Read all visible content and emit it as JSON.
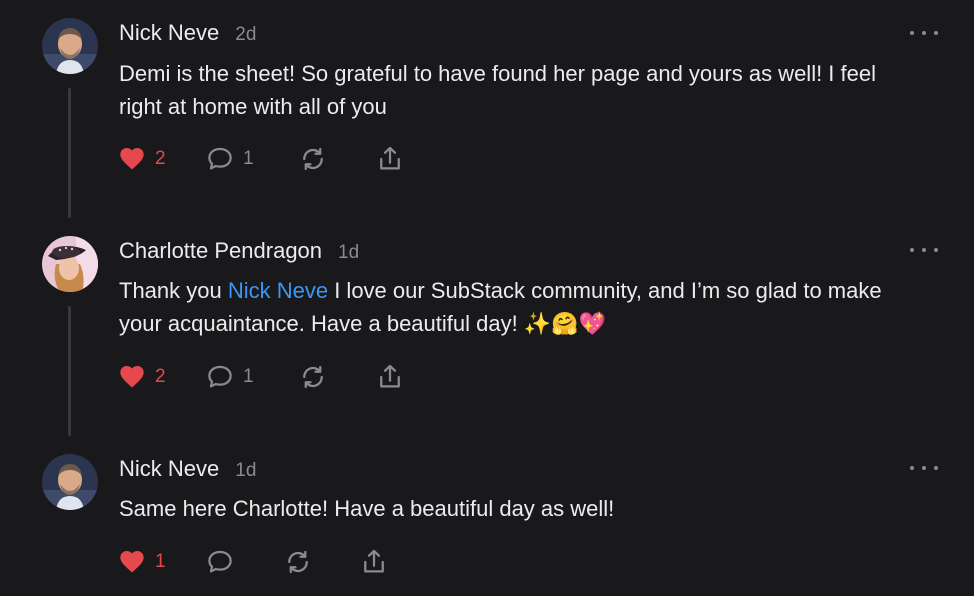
{
  "theme": {
    "background": "#19191b",
    "text": "#ececee",
    "muted": "#8a8a90",
    "like_color": "#e5484d",
    "mention_color": "#3a97f5"
  },
  "comments": [
    {
      "author": "Nick Neve",
      "time": "2d",
      "avatar_icon": "user-avatar-nick",
      "body": [
        {
          "text": "Demi is the sheet! So grateful to have found her page and yours as well! I feel right at home with all of you"
        }
      ],
      "likes": "2",
      "replies": "1"
    },
    {
      "author": "Charlotte Pendragon",
      "time": "1d",
      "avatar_icon": "user-avatar-charlotte",
      "body_prefix": "Thank you ",
      "mention": "Nick Neve",
      "body_suffix": " I love our SubStack community, and I’m so glad to make your acquaintance. Have a beautiful day! ✨🤗💖",
      "likes": "2",
      "replies": "1"
    },
    {
      "author": "Nick Neve",
      "time": "1d",
      "avatar_icon": "user-avatar-nick",
      "body": [
        {
          "text": "Same here Charlotte! Have a beautiful day as well!"
        }
      ],
      "likes": "1",
      "replies": ""
    }
  ]
}
